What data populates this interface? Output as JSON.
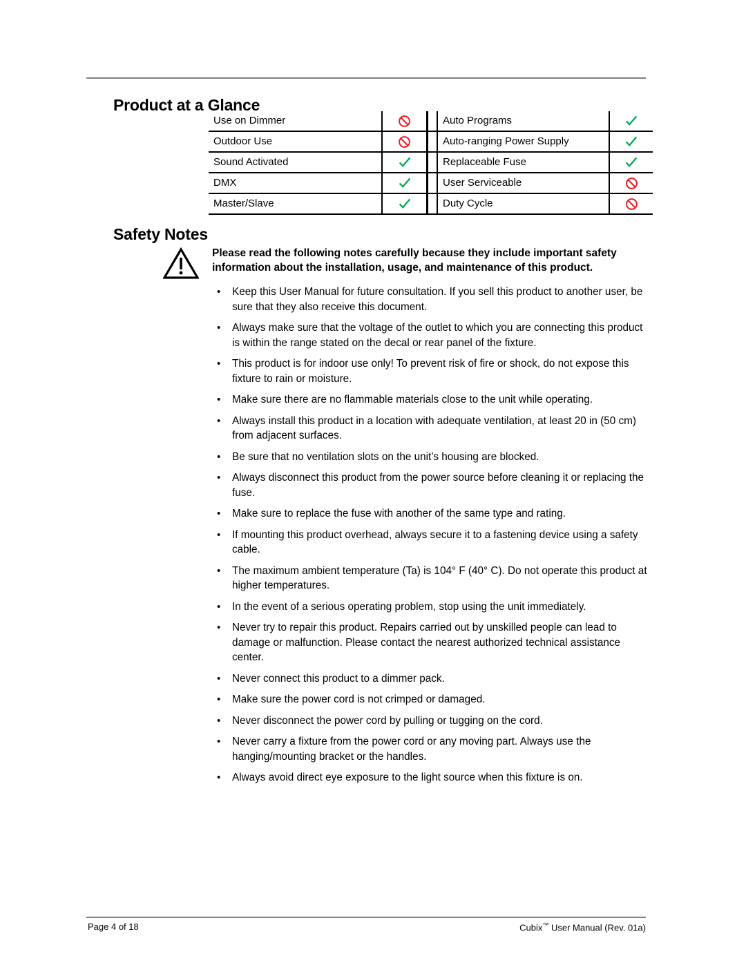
{
  "document": {
    "page_background": "#ffffff",
    "text_color": "#000000",
    "rule_color": "#808080"
  },
  "sections": {
    "product_at_a_glance": {
      "heading": "Product at a Glance"
    },
    "safety_notes": {
      "heading": "Safety Notes",
      "warning_icon": "warning-triangle-icon",
      "warning_text": "Please read the following notes carefully because they include important safety information about the installation, usage, and maintenance of this product."
    }
  },
  "glance_table": {
    "check_color": "#00A651",
    "no_color": "#ED1C24",
    "rows": [
      {
        "left_label": "Use on Dimmer",
        "left_mark": "no",
        "right_label": "Auto Programs",
        "right_mark": "check"
      },
      {
        "left_label": "Outdoor Use",
        "left_mark": "no",
        "right_label": "Auto-ranging Power Supply",
        "right_mark": "check"
      },
      {
        "left_label": "Sound Activated",
        "left_mark": "check",
        "right_label": "Replaceable Fuse",
        "right_mark": "check"
      },
      {
        "left_label": "DMX",
        "left_mark": "check",
        "right_label": "User Serviceable",
        "right_mark": "no"
      },
      {
        "left_label": "Master/Slave",
        "left_mark": "check",
        "right_label": "Duty Cycle",
        "right_mark": "no"
      }
    ]
  },
  "safety_bullets": [
    "Keep this User Manual for future consultation. If you sell this product to another user, be sure that they also receive this document.",
    "Always make sure that the voltage of the outlet to which you are connecting this product is within the range stated on the decal or rear panel of the fixture.",
    "This product is for indoor use only! To prevent risk of fire or shock, do not expose this fixture to rain or moisture.",
    "Make sure there are no flammable materials close to the unit while operating.",
    "Always install this product in a location with adequate ventilation, at least 20 in (50 cm) from adjacent surfaces.",
    "Be sure that no ventilation slots on the unit’s housing are blocked.",
    "Always disconnect this product from the power source before cleaning it or replacing the fuse.",
    "Make sure to replace the fuse with another of the same type and rating.",
    "If mounting this product overhead, always secure it to a fastening device using a safety cable.",
    "The maximum ambient temperature (Ta) is 104° F (40° C). Do not operate this product at higher temperatures.",
    "In the event of a serious operating problem, stop using the unit immediately.",
    "Never try to repair this product. Repairs carried out by unskilled people can lead to damage or malfunction. Please contact the nearest authorized technical assistance center.",
    "Never connect this product to a dimmer pack.",
    "Make sure the power cord is not crimped or damaged.",
    "Never disconnect the power cord by pulling or tugging on the cord.",
    "Never carry a fixture from the power cord or any moving part. Always use the hanging/mounting bracket or the handles.",
    "Always avoid direct eye exposure to the light source when this fixture is on."
  ],
  "bullet_glyph": "•",
  "footer": {
    "page_label": "Page 4 of 18",
    "manual_name": "Cubix",
    "trademark": "™",
    "manual_suffix": " User Manual (Rev. 01a)"
  }
}
